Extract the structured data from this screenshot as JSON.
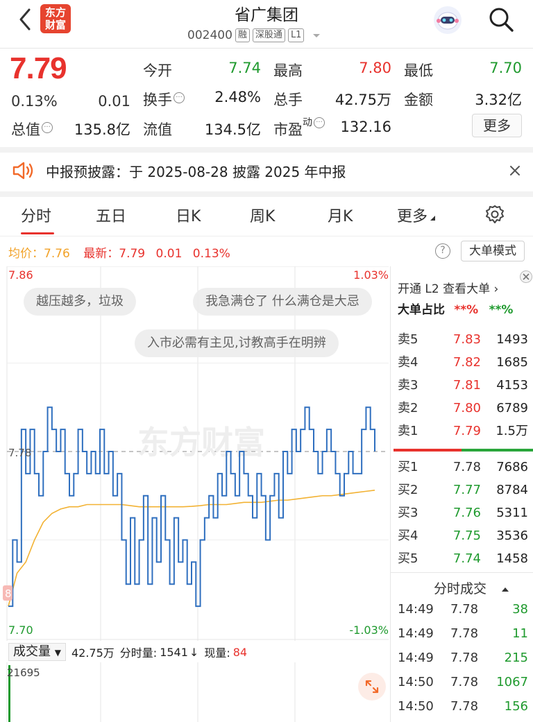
{
  "header": {
    "logo_line1": "东方",
    "logo_line2": "财富",
    "stock_name": "省广集团",
    "stock_code": "002400",
    "tags": [
      "融",
      "深股通",
      "L1"
    ]
  },
  "quote": {
    "price": "7.79",
    "change_pct": "0.13%",
    "change_amt": "0.01",
    "fields": [
      {
        "label": "今开",
        "value": "7.74",
        "color": "green"
      },
      {
        "label": "最高",
        "value": "7.80",
        "color": "red"
      },
      {
        "label": "最低",
        "value": "7.70",
        "color": "green"
      },
      {
        "label": "换手",
        "value": "2.48%",
        "color": "normal"
      },
      {
        "label": "总手",
        "value": "42.75万",
        "color": "normal"
      },
      {
        "label": "金额",
        "value": "3.32亿",
        "color": "normal"
      },
      {
        "label": "总值",
        "value": "135.8亿",
        "color": "normal"
      },
      {
        "label": "流值",
        "value": "134.5亿",
        "color": "normal"
      },
      {
        "label": "市盈",
        "label_sup": "动",
        "value": "132.16",
        "color": "normal"
      }
    ],
    "more_button": "更多"
  },
  "notice": {
    "text": "中报预披露：于 2025-08-28 披露 2025 年中报"
  },
  "tabs": [
    "分时",
    "五日",
    "日K",
    "周K",
    "月K",
    "更多"
  ],
  "avg_row": {
    "avg_label": "均价：",
    "avg_value": "7.76",
    "latest_label": "最新：",
    "latest_value": "7.79",
    "change_amt": "0.01",
    "change_pct": "0.13%"
  },
  "big_order_button": "大单模式",
  "chart": {
    "y_top_label": "7.86",
    "y_bottom_label": "7.70",
    "pct_top_label": "1.03%",
    "pct_bottom_label": "-1.03%",
    "ref_label": "7.78",
    "watermark": "东方财富",
    "left_marker": "8"
  },
  "bubbles": [
    "越压越多，垃圾",
    "我急满仓了 什么满仓是大忌",
    "入市必需有主见,讨教高手在明辨"
  ],
  "chart_data": {
    "type": "line",
    "title": "",
    "ylim": [
      7.7,
      7.86
    ],
    "prev_close": 7.78,
    "series": [
      {
        "name": "price",
        "values": [
          7.71,
          7.74,
          7.73,
          7.79,
          7.77,
          7.79,
          7.77,
          7.76,
          7.78,
          7.8,
          7.79,
          7.78,
          7.79,
          7.77,
          7.76,
          7.77,
          7.79,
          7.78,
          7.77,
          7.78,
          7.77,
          7.79,
          7.77,
          7.78,
          7.76,
          7.77,
          7.74,
          7.72,
          7.75,
          7.72,
          7.74,
          7.76,
          7.72,
          7.75,
          7.73,
          7.76,
          7.74,
          7.72,
          7.75,
          7.73,
          7.74,
          7.72,
          7.73,
          7.71,
          7.74,
          7.75,
          7.76,
          7.75,
          7.77,
          7.76,
          7.78,
          7.77,
          7.76,
          7.78,
          7.77,
          7.76,
          7.75,
          7.77,
          7.76,
          7.74,
          7.76,
          7.77,
          7.75,
          7.78,
          7.77,
          7.79,
          7.78,
          7.79,
          7.8,
          7.79,
          7.78,
          7.77,
          7.78,
          7.79,
          7.78,
          7.77,
          7.76,
          7.77,
          7.78,
          7.77,
          7.77,
          7.79,
          7.8,
          7.79,
          7.78
        ]
      },
      {
        "name": "avg",
        "values": [
          7.71,
          7.725,
          7.73,
          7.74,
          7.748,
          7.752,
          7.754,
          7.755,
          7.755,
          7.756,
          7.756,
          7.756,
          7.756,
          7.756,
          7.7555,
          7.755,
          7.755,
          7.755,
          7.755,
          7.755,
          7.755,
          7.7552,
          7.7555,
          7.756,
          7.756,
          7.756,
          7.7565,
          7.757,
          7.757,
          7.757,
          7.7575,
          7.758,
          7.758,
          7.7585,
          7.759,
          7.7595,
          7.76,
          7.76,
          7.7605,
          7.761,
          7.7615,
          7.762,
          7.7625
        ]
      }
    ],
    "volume": {
      "total": "42.75万",
      "period_volume": "1541",
      "current_volume": "84",
      "max_label": "21695"
    }
  },
  "right_panel": {
    "l2_prompt": "开通 L2 查看大单 ›",
    "ratio_label": "大单占比",
    "ratio_buy": "**%",
    "ratio_sell": "**%",
    "asks": [
      {
        "label": "卖5",
        "price": "7.83",
        "vol": "1493",
        "color": "red"
      },
      {
        "label": "卖4",
        "price": "7.82",
        "vol": "1685",
        "color": "red"
      },
      {
        "label": "卖3",
        "price": "7.81",
        "vol": "4153",
        "color": "red"
      },
      {
        "label": "卖2",
        "price": "7.80",
        "vol": "6789",
        "color": "red"
      },
      {
        "label": "卖1",
        "price": "7.79",
        "vol": "1.5万",
        "color": "red"
      }
    ],
    "bids": [
      {
        "label": "买1",
        "price": "7.78",
        "vol": "7686",
        "color": "normal"
      },
      {
        "label": "买2",
        "price": "7.77",
        "vol": "8784",
        "color": "green"
      },
      {
        "label": "买3",
        "price": "7.76",
        "vol": "5311",
        "color": "green"
      },
      {
        "label": "买4",
        "price": "7.75",
        "vol": "3536",
        "color": "green"
      },
      {
        "label": "买5",
        "price": "7.74",
        "vol": "1458",
        "color": "green"
      }
    ],
    "trades_title": "分时成交",
    "trades": [
      {
        "time": "14:49",
        "price": "7.78",
        "vol": "38"
      },
      {
        "time": "14:49",
        "price": "7.78",
        "vol": "11"
      },
      {
        "time": "14:49",
        "price": "7.78",
        "vol": "215"
      },
      {
        "time": "14:50",
        "price": "7.78",
        "vol": "1067"
      },
      {
        "time": "14:50",
        "price": "7.78",
        "vol": "156"
      }
    ]
  },
  "volume_row": {
    "selector_label": "成交量",
    "total": "42.75万",
    "period_label": "分时量:",
    "period_value": "1541",
    "current_label": "现量:",
    "current_value": "84"
  },
  "colors": {
    "red": "#e8322d",
    "green": "#1f9a2e",
    "price_line": "#2f6fbf",
    "avg_line": "#f2b233"
  }
}
